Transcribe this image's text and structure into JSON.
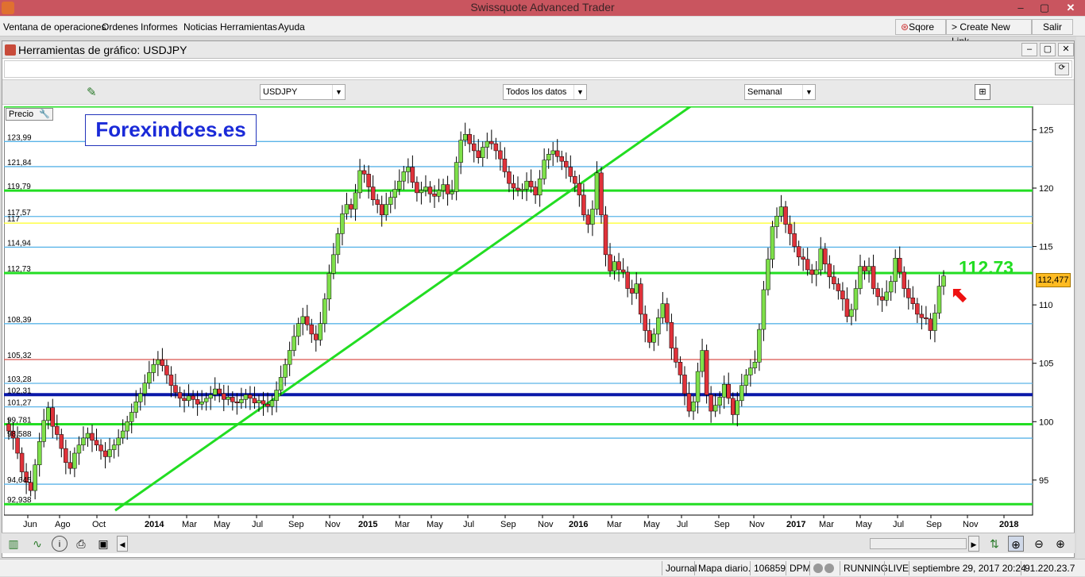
{
  "window": {
    "title": "Swissquote Advanced Trader"
  },
  "menu": {
    "items": [
      "Ventana de operaciones",
      "Ordenes",
      "Informes",
      "Noticias",
      "Herramientas",
      "Ayuda"
    ],
    "sqore": "Sqore",
    "create_link": "> Create New Link",
    "exit": "Salir"
  },
  "panel": {
    "title": "Herramientas de gráfico: USDJPY"
  },
  "toolbar": {
    "symbol": "USDJPY",
    "range": "Todos los datos",
    "period": "Semanal"
  },
  "chart": {
    "price_button": "Precio",
    "watermark": "Forexindces.es",
    "annotation": "112.73",
    "current_price": "112,477"
  },
  "chart_data": {
    "type": "candlestick",
    "ylim": [
      92,
      127
    ],
    "yticks_right": [
      "125",
      "120",
      "115",
      "110",
      "105",
      "100",
      "95"
    ],
    "level_labels": [
      "123,99",
      "121,84",
      "119,79",
      "117,57",
      "117",
      "114,94",
      "112,73",
      "108,39",
      "105,32",
      "103,28",
      "102,31",
      "101,27",
      "99,781",
      "98,588",
      "94,645",
      "92,938"
    ],
    "x_labels": [
      "Jun",
      "Ago",
      "Oct",
      "2014",
      "Mar",
      "May",
      "Jul",
      "Sep",
      "Nov",
      "2015",
      "Mar",
      "May",
      "Jul",
      "Sep",
      "Nov",
      "2016",
      "Mar",
      "May",
      "Jul",
      "Sep",
      "Nov",
      "2017",
      "Mar",
      "May",
      "Jul",
      "Sep",
      "Nov",
      "2018"
    ],
    "horizontal_lines": [
      {
        "value": 127.0,
        "color": "#22dd22"
      },
      {
        "value": 123.99,
        "color": "#5ab4e8"
      },
      {
        "value": 121.84,
        "color": "#5ab4e8"
      },
      {
        "value": 119.79,
        "color": "#22dd22"
      },
      {
        "value": 117.57,
        "color": "#5ab4e8"
      },
      {
        "value": 117.0,
        "color": "#ffff22"
      },
      {
        "value": 114.94,
        "color": "#5ab4e8"
      },
      {
        "value": 112.73,
        "color": "#22dd22"
      },
      {
        "value": 108.39,
        "color": "#5ab4e8"
      },
      {
        "value": 105.32,
        "color": "#d9534f"
      },
      {
        "value": 103.28,
        "color": "#5ab4e8"
      },
      {
        "value": 102.31,
        "color": "#0a18a8"
      },
      {
        "value": 101.27,
        "color": "#5ab4e8"
      },
      {
        "value": 99.781,
        "color": "#22dd22"
      },
      {
        "value": 98.588,
        "color": "#5ab4e8"
      },
      {
        "value": 94.645,
        "color": "#5ab4e8"
      },
      {
        "value": 92.938,
        "color": "#22dd22"
      }
    ],
    "trendline": {
      "from": [
        "2013-10",
        92.4
      ],
      "to": [
        "2016-05",
        127.5
      ],
      "color": "#22dd22"
    },
    "closes": [
      99.2,
      98.6,
      97.3,
      95.7,
      94.8,
      94.1,
      96.3,
      98.3,
      100.1,
      101.2,
      99.6,
      98.9,
      97.7,
      96.5,
      96.0,
      97.3,
      98.0,
      98.6,
      99.0,
      98.4,
      98.0,
      97.5,
      97.0,
      97.6,
      98.0,
      98.6,
      99.2,
      100.0,
      100.8,
      101.7,
      102.4,
      103.3,
      104.2,
      104.9,
      105.3,
      104.8,
      104.0,
      103.1,
      102.5,
      102.0,
      101.8,
      102.2,
      101.9,
      101.5,
      101.7,
      102.0,
      102.3,
      102.8,
      102.4,
      101.9,
      102.1,
      101.7,
      101.6,
      101.9,
      102.3,
      102.0,
      101.6,
      101.8,
      101.5,
      101.3,
      101.8,
      102.7,
      103.8,
      104.9,
      106.1,
      107.3,
      108.4,
      109.0,
      108.3,
      107.5,
      107.0,
      108.4,
      110.5,
      112.7,
      114.3,
      116.1,
      117.8,
      118.6,
      118.2,
      119.6,
      121.5,
      121.2,
      120.1,
      119.0,
      118.6,
      117.7,
      118.6,
      119.2,
      119.9,
      120.6,
      121.4,
      121.8,
      120.5,
      119.6,
      119.8,
      120.1,
      119.5,
      119.3,
      119.8,
      120.3,
      119.5,
      119.7,
      122.2,
      124.1,
      124.6,
      123.8,
      123.2,
      122.6,
      123.5,
      124.0,
      123.8,
      123.2,
      122.5,
      121.4,
      120.4,
      120.0,
      119.8,
      119.9,
      120.6,
      120.1,
      119.4,
      120.8,
      122.4,
      122.9,
      123.2,
      122.7,
      122.3,
      121.8,
      121.0,
      120.4,
      119.4,
      117.7,
      116.9,
      118.2,
      121.3,
      117.7,
      114.3,
      112.9,
      113.7,
      113.0,
      112.8,
      111.4,
      111.0,
      111.8,
      109.2,
      107.8,
      106.8,
      107.5,
      108.9,
      110.1,
      108.5,
      106.3,
      105.1,
      104.0,
      102.4,
      100.9,
      101.7,
      104.3,
      106.1,
      102.3,
      100.9,
      101.4,
      102.1,
      103.2,
      102.0,
      100.6,
      101.8,
      103.1,
      104.0,
      104.6,
      105.1,
      107.9,
      111.3,
      113.9,
      116.7,
      117.6,
      118.4,
      116.9,
      116.1,
      115.0,
      114.1,
      113.9,
      113.0,
      112.6,
      113.0,
      114.8,
      113.5,
      112.4,
      111.8,
      111.2,
      110.5,
      109.0,
      109.6,
      111.4,
      113.3,
      112.9,
      113.3,
      111.4,
      110.7,
      110.4,
      111.1,
      112.0,
      114.0,
      112.8,
      111.4,
      110.6,
      110.1,
      109.2,
      108.9,
      108.8,
      107.8,
      109.3,
      111.6,
      112.477
    ],
    "last_price": 112.477
  },
  "bottom": {
    "icons": [
      "chart-type",
      "indicator",
      "info",
      "print",
      "save"
    ]
  },
  "status": {
    "journal": "Journal",
    "map": "Mapa diario.",
    "code": "106859",
    "dpm": "DPM",
    "running": "RUNNING",
    "live": "LIVE",
    "datetime": "septiembre 29, 2017 20:24",
    "ip": "91.220.23.7"
  }
}
